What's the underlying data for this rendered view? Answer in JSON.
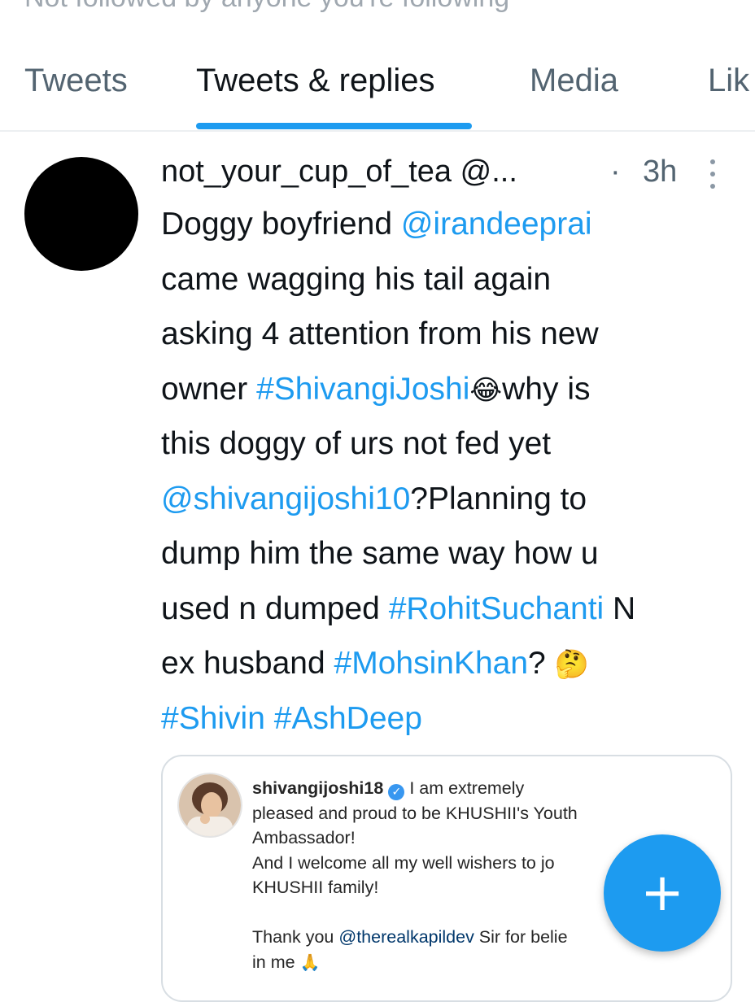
{
  "colors": {
    "accent": "#1d9bf0",
    "text": "#0f1419",
    "muted": "#536471"
  },
  "profile_context": {
    "followed_by_text": "Not followed by anyone you're following"
  },
  "tabs": [
    {
      "label": "Tweets",
      "active": false
    },
    {
      "label": "Tweets & replies",
      "active": true
    },
    {
      "label": "Media",
      "active": false
    },
    {
      "label": "Lik",
      "active": false
    }
  ],
  "tweet": {
    "avatar_color": "#000000",
    "author": "not_your_cup_of_tea @...",
    "separator": "·",
    "time": "3h",
    "more_icon": "more-vertical-icon",
    "lines": [
      [
        {
          "t": "Doggy boyfriend "
        },
        {
          "t": "@irandeeprai",
          "link": true
        }
      ],
      [
        {
          "t": "came wagging his tail again"
        }
      ],
      [
        {
          "t": "asking 4 attention from his new"
        }
      ],
      [
        {
          "t": "owner "
        },
        {
          "t": "#ShivangiJoshi",
          "link": true
        },
        {
          "t": "😂",
          "emoji": true
        },
        {
          "t": "why is"
        }
      ],
      [
        {
          "t": "this doggy of urs not fed yet"
        }
      ],
      [
        {
          "t": "@shivangijoshi10",
          "link": true
        },
        {
          "t": "?Planning to"
        }
      ],
      [
        {
          "t": "dump him the same way how u"
        }
      ],
      [
        {
          "t": "used n dumped "
        },
        {
          "t": "#RohitSuchanti",
          "link": true
        },
        {
          "t": " N"
        }
      ],
      [
        {
          "t": "ex husband "
        },
        {
          "t": "#MohsinKhan",
          "link": true
        },
        {
          "t": "? "
        },
        {
          "t": "🤔",
          "emoji": true
        }
      ],
      [
        {
          "t": "#Shivin",
          "link": true
        },
        {
          "t": " "
        },
        {
          "t": "#AshDeep",
          "link": true
        }
      ]
    ],
    "quoted_image": {
      "username": "shivangijoshi18",
      "verified_icon": "verified-badge-icon",
      "lines": [
        [
          {
            "t": "I am extremely"
          }
        ],
        [
          {
            "t": "pleased and proud to be KHUSHII's Youth"
          }
        ],
        [
          {
            "t": "Ambassador!"
          }
        ],
        [
          {
            "t": "And I welcome all my well wishers to jo"
          }
        ],
        [
          {
            "t": "KHUSHII family!"
          }
        ],
        [
          {
            "t": ""
          }
        ],
        [
          {
            "t": "Thank you "
          },
          {
            "t": "@therealkapildev",
            "mention": true
          },
          {
            "t": " Sir for belie"
          }
        ],
        [
          {
            "t": "in me "
          },
          {
            "t": "🙏",
            "emoji": true
          }
        ]
      ]
    }
  },
  "compose_button": {
    "icon": "plus-icon",
    "symbol": "+"
  }
}
